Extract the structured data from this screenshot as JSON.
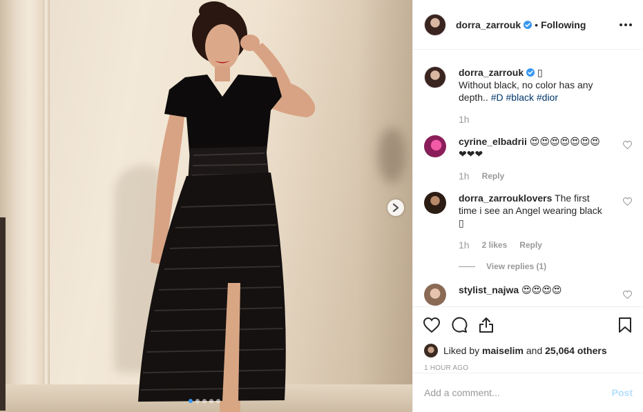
{
  "post": {
    "author": "dorra_zarrouk",
    "separator": "•",
    "follow_status": "Following",
    "caption": {
      "username": "dorra_zarrouk",
      "emoji": "▯",
      "text": "Without black, no color has any depth..",
      "hashtags": [
        "#D",
        "#black",
        "#dior"
      ],
      "time": "1h"
    },
    "carousel": {
      "slide_count": 5,
      "active_index": 0
    }
  },
  "comments": [
    {
      "username": "cyrine_elbadrii",
      "text": "😍😍😍😍😍😍😍❤❤❤",
      "time": "1h",
      "likes": "",
      "reply": "Reply"
    },
    {
      "username": "dorra_zarrouklovers",
      "text": "The first time i see an Angel wearing black ▯",
      "time": "1h",
      "likes": "2 likes",
      "reply": "Reply",
      "view_replies": "View replies (1)"
    },
    {
      "username": "stylist_najwa",
      "text": "😍😍😍😍"
    }
  ],
  "likes": {
    "prefix": "Liked by",
    "liker": "maiselim",
    "and": "and",
    "others": "25,064 others"
  },
  "timestamp": "1 HOUR AGO",
  "comment_box": {
    "placeholder": "Add a comment...",
    "post_label": "Post"
  },
  "colors": {
    "link": "#003569",
    "verified": "#3897f0",
    "post_disabled": "#b2dffc"
  }
}
